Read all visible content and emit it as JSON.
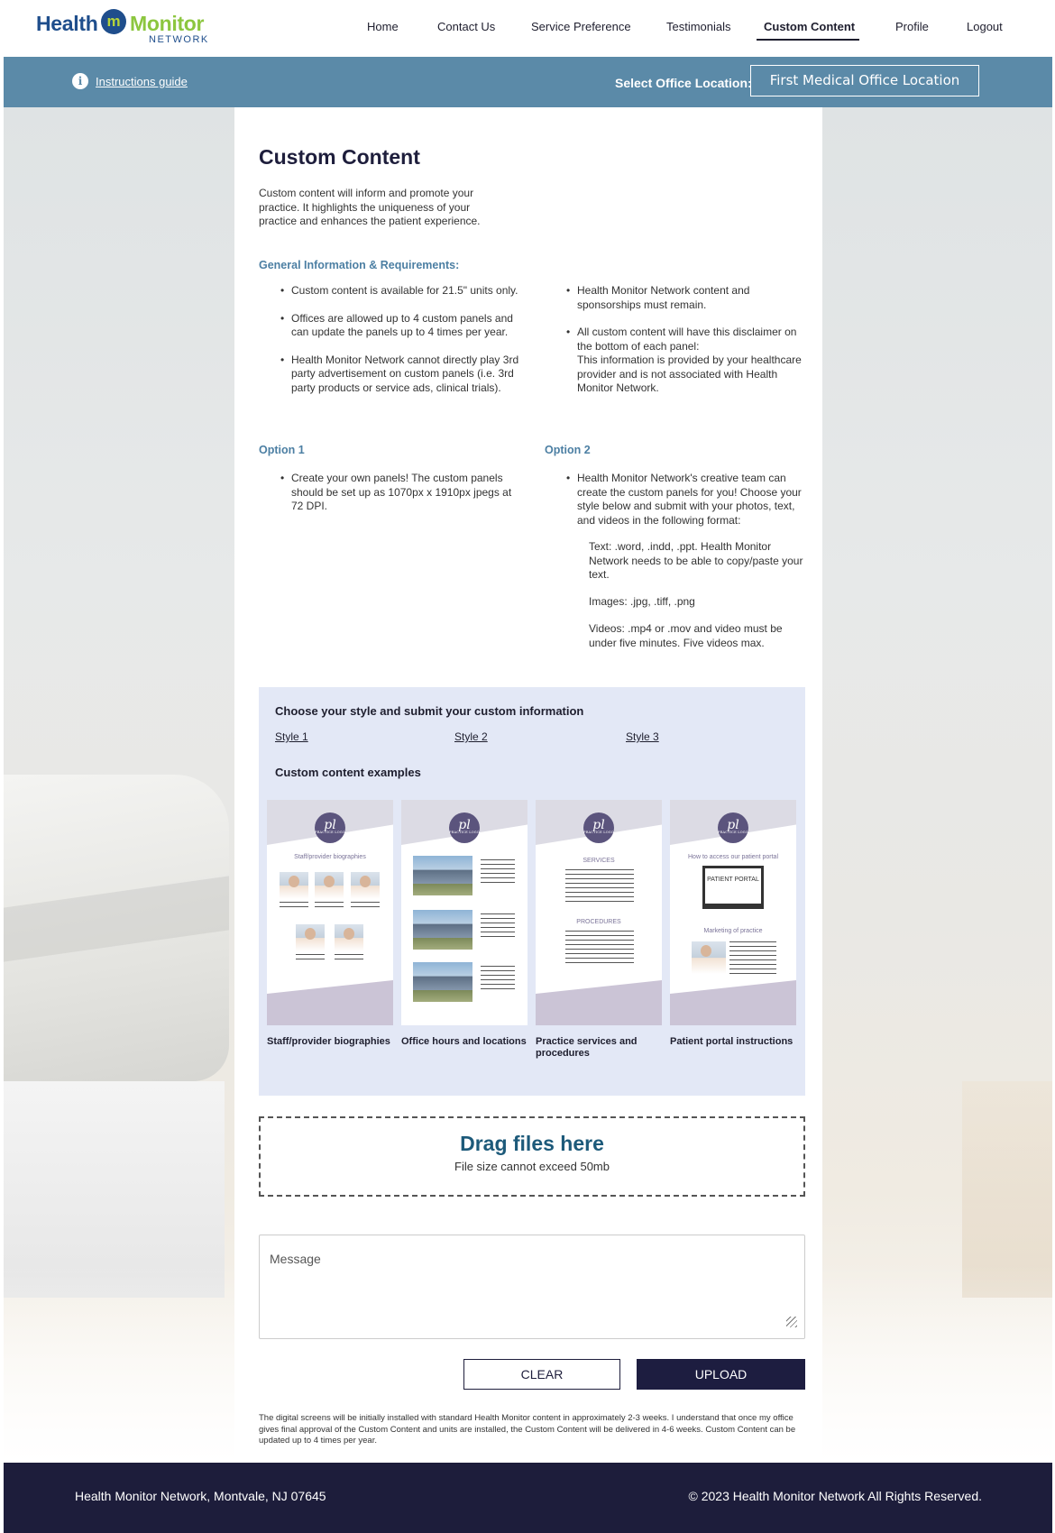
{
  "brand": {
    "word1": "Health",
    "mark": "m",
    "word2": "Monitor",
    "sub": "NETWORK"
  },
  "nav": [
    {
      "label": "Home"
    },
    {
      "label": "Contact Us"
    },
    {
      "label": "Service Preference"
    },
    {
      "label": "Testimonials"
    },
    {
      "label": "Custom Content",
      "active": true
    },
    {
      "label": "Profile"
    },
    {
      "label": "Logout"
    }
  ],
  "location_bar": {
    "guide_icon": "info-icon",
    "guide_label": "Instructions guide",
    "select_label": "Select Office Location:",
    "selected_location": "First Medical Office Location"
  },
  "page": {
    "title": "Custom Content",
    "intro": "Custom content will inform and promote your practice. It highlights the uniqueness of your practice and enhances the patient experience.",
    "general_heading": "General Information & Requirements:",
    "general_left": [
      "Custom content is available for 21.5\" units only.",
      "Offices are allowed up to 4 custom panels and can update the panels up to 4 times per year.",
      "Health Monitor Network cannot directly play 3rd party advertisement on custom panels (i.e. 3rd party products or service ads, clinical trials)."
    ],
    "general_right": [
      "Health Monitor Network content and sponsorships must remain.",
      "All custom content will have this disclaimer on the bottom of each panel:",
      "This information is provided by your healthcare provider and is not associated with Health Monitor Network."
    ],
    "option1_heading": "Option 1",
    "option1_items": [
      "Create your own panels! The custom panels should be set up as 1070px x 1910px jpegs at 72 DPI."
    ],
    "option2_heading": "Option 2",
    "option2_items": [
      "Health Monitor Network's creative team can create the custom panels for you! Choose your style below and submit with your photos, text, and videos in the following format:"
    ],
    "formats": [
      "Text: .word, .indd, .ppt. Health Monitor Network needs to be able to copy/paste your text.",
      "Images: .jpg, .tiff, .png",
      "Videos: .mp4 or .mov and video must be under five minutes. Five videos max."
    ]
  },
  "style_box": {
    "title": "Choose your style and submit your custom information",
    "styles": [
      "Style 1",
      "Style 2",
      "Style 3"
    ],
    "examples_heading": "Custom content examples",
    "logo_text": "pl",
    "cards": [
      {
        "heading": "Staff/provider biographies",
        "label": "Staff/provider biographies"
      },
      {
        "heading": "",
        "label": "Office hours and locations"
      },
      {
        "heading": "SERVICES",
        "heading2": "PROCEDURES",
        "label": "Practice services and procedures"
      },
      {
        "heading": "How to access our patient portal",
        "screen": "PATIENT PORTAL",
        "heading2": "Marketing of practice",
        "label": "Patient portal instructions"
      }
    ]
  },
  "upload": {
    "drop_title": "Drag files here",
    "drop_sub": "File size cannot exceed 50mb",
    "message_placeholder": "Message",
    "clear_label": "CLEAR",
    "upload_label": "UPLOAD"
  },
  "disclaimer": "The digital screens will be initially installed with standard Health Monitor content in approximately 2-3 weeks. I understand that once my office gives final approval of the Custom Content and units are installed, the Custom Content will be delivered in 4-6 weeks. Custom Content can be updated up to 4 times per year.",
  "footer": {
    "address": "Health Monitor Network, Montvale, NJ 07645",
    "copyright": "© 2023 Health Monitor Network All Rights Reserved."
  },
  "colors": {
    "brand_blue": "#1f4e8c",
    "brand_green": "#8cc63f",
    "location_bar": "#5b8aa8",
    "heading_blue": "#4c7fa3",
    "style_box_bg": "#e3e8f6",
    "footer_bg": "#1d1d3b"
  }
}
